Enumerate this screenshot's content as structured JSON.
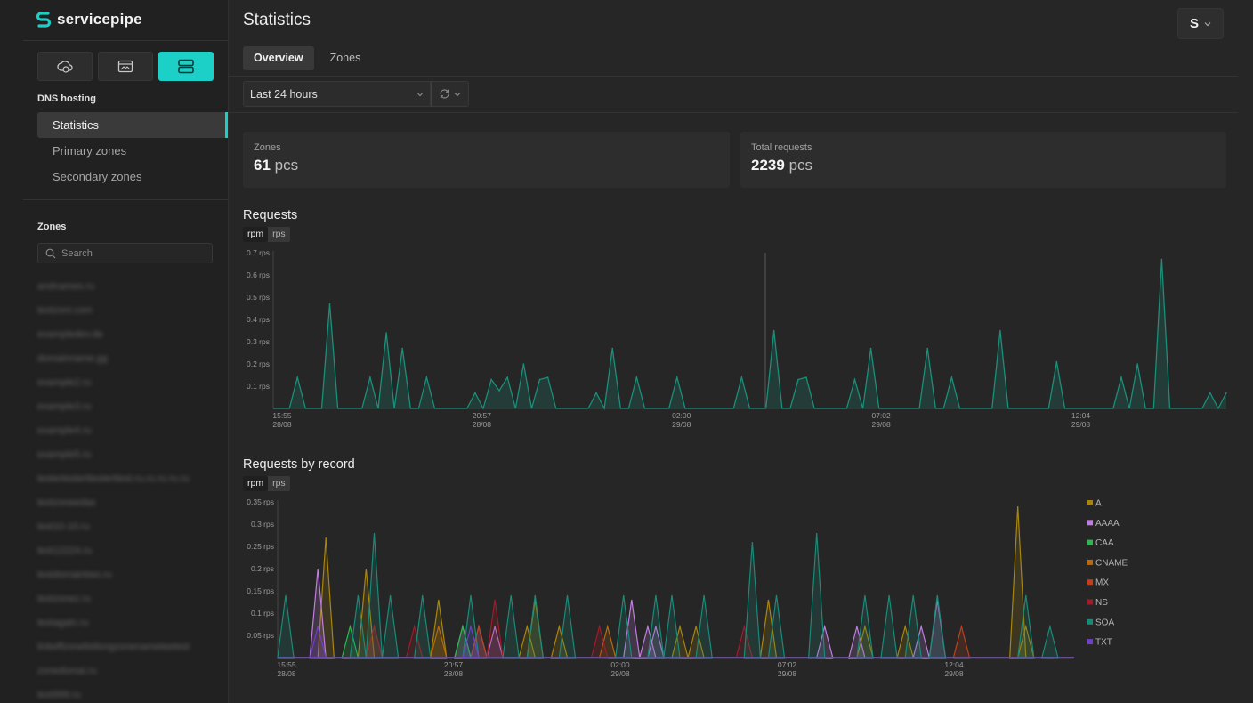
{
  "app": {
    "name": "servicepipe"
  },
  "sidebar": {
    "section_label": "DNS hosting",
    "nav": [
      "Statistics",
      "Primary zones",
      "Secondary zones"
    ],
    "zones_label": "Zones",
    "search_placeholder": "Search",
    "zones": [
      "andnames.ru",
      "testzoni.com",
      "exampledev.de",
      "domainname.gg",
      "example2.ru",
      "example3.ru",
      "example4.ru",
      "example5.ru",
      "testertesterttesterttest.ru.ru.ru.ru.ru",
      "testzoneedas",
      "test10-10.ru",
      "test12224.ru",
      "testdomaintwo.ru",
      "testzonez.ru",
      "testagain.ru",
      "linkeffzonelistlongzonenameteetest",
      "zonedomai.ru",
      "test999.ru"
    ]
  },
  "header": {
    "title": "Statistics",
    "user_initial": "S"
  },
  "tabs": [
    "Overview",
    "Zones"
  ],
  "filters": {
    "range": "Last 24 hours"
  },
  "cards": {
    "zones": {
      "label": "Zones",
      "value": "61",
      "unit": "pcs"
    },
    "requests": {
      "label": "Total requests",
      "value": "2239",
      "unit": "pcs"
    }
  },
  "requests": {
    "title": "Requests",
    "units": [
      "rpm",
      "rps"
    ],
    "selected_unit": "rpm"
  },
  "requests_by_record": {
    "title": "Requests by record",
    "units": [
      "rpm",
      "rps"
    ],
    "selected_unit": "rpm"
  },
  "colors": {
    "accent": "#1ccfc7",
    "line": "#1a8f7a"
  },
  "chart_data": [
    {
      "type": "area",
      "title": "Requests",
      "ylim": [
        0,
        0.7
      ],
      "yticks": [
        "0.1 rps",
        "0.2 rps",
        "0.3 rps",
        "0.4 rps",
        "0.5 rps",
        "0.6 rps",
        "0.7 rps"
      ],
      "xticks": [
        [
          "15:55",
          "28/08"
        ],
        [
          "20:57",
          "28/08"
        ],
        [
          "02:00",
          "29/08"
        ],
        [
          "07:02",
          "29/08"
        ],
        [
          "12:04",
          "29/08"
        ]
      ],
      "grid": false,
      "series": [
        {
          "values": [
            0,
            0,
            0,
            0.14,
            0,
            0,
            0,
            0.47,
            0,
            0,
            0,
            0,
            0.14,
            0,
            0.34,
            0,
            0.27,
            0,
            0,
            0.14,
            0,
            0,
            0,
            0,
            0,
            0.07,
            0,
            0.13,
            0.08,
            0.14,
            0,
            0.2,
            0,
            0.13,
            0.14,
            0,
            0,
            0,
            0,
            0,
            0.07,
            0,
            0.27,
            0,
            0,
            0.14,
            0,
            0,
            0,
            0,
            0.14,
            0,
            0,
            0,
            0,
            0,
            0,
            0,
            0.14,
            0,
            0,
            0,
            0.35,
            0,
            0,
            0.13,
            0.14,
            0,
            0,
            0,
            0,
            0,
            0.13,
            0,
            0.27,
            0,
            0,
            0,
            0,
            0,
            0,
            0.27,
            0,
            0,
            0.14,
            0,
            0,
            0,
            0,
            0,
            0.35,
            0,
            0,
            0,
            0,
            0,
            0,
            0.21,
            0,
            0,
            0,
            0,
            0,
            0,
            0,
            0.14,
            0,
            0.2,
            0,
            0,
            0.67,
            0,
            0,
            0,
            0,
            0,
            0.07,
            0,
            0.07
          ],
          "color": "#1a8f7a"
        }
      ]
    },
    {
      "type": "area",
      "title": "Requests by record",
      "ylim": [
        0,
        0.35
      ],
      "yticks": [
        "0.05 rps",
        "0.1 rps",
        "0.15 rps",
        "0.2 rps",
        "0.25 rps",
        "0.3 rps",
        "0.35 rps"
      ],
      "xticks": [
        [
          "15:55",
          "28/08"
        ],
        [
          "20:57",
          "28/08"
        ],
        [
          "02:00",
          "29/08"
        ],
        [
          "07:02",
          "29/08"
        ],
        [
          "12:04",
          "29/08"
        ]
      ],
      "legend_position": "right",
      "series": [
        {
          "name": "A",
          "color": "#a8860c",
          "points": [
            [
              6,
              0.27
            ],
            [
              11,
              0.2
            ],
            [
              20,
              0.13
            ],
            [
              31,
              0.07
            ],
            [
              32,
              0.13
            ],
            [
              35,
              0.07
            ],
            [
              50,
              0.07
            ],
            [
              52,
              0.07
            ],
            [
              61,
              0.13
            ],
            [
              73,
              0.07
            ],
            [
              78,
              0.07
            ],
            [
              92,
              0.34
            ],
            [
              93,
              0.07
            ]
          ]
        },
        {
          "name": "AAAA",
          "color": "#c07fe0",
          "points": [
            [
              5,
              0.2
            ],
            [
              23,
              0.07
            ],
            [
              25,
              0.07
            ],
            [
              27,
              0.07
            ],
            [
              44,
              0.13
            ],
            [
              46,
              0.07
            ],
            [
              47,
              0.07
            ],
            [
              68,
              0.07
            ],
            [
              72,
              0.07
            ],
            [
              80,
              0.07
            ],
            [
              82,
              0.13
            ]
          ]
        },
        {
          "name": "CAA",
          "color": "#2ab84f",
          "points": [
            [
              9,
              0.07
            ],
            [
              23,
              0.07
            ]
          ]
        },
        {
          "name": "CNAME",
          "color": "#b86a0d",
          "points": [
            [
              20,
              0.07
            ],
            [
              41,
              0.07
            ]
          ]
        },
        {
          "name": "MX",
          "color": "#c0401a",
          "points": [
            [
              12,
              0.07
            ],
            [
              25,
              0.07
            ],
            [
              85,
              0.07
            ]
          ]
        },
        {
          "name": "NS",
          "color": "#a01c2a",
          "points": [
            [
              12,
              0.07
            ],
            [
              17,
              0.07
            ],
            [
              27,
              0.13
            ],
            [
              40,
              0.07
            ],
            [
              58,
              0.07
            ]
          ]
        },
        {
          "name": "SOA",
          "color": "#1a8a78",
          "points": [
            [
              1,
              0.14
            ],
            [
              10,
              0.14
            ],
            [
              12,
              0.28
            ],
            [
              14,
              0.14
            ],
            [
              18,
              0.14
            ],
            [
              24,
              0.14
            ],
            [
              29,
              0.14
            ],
            [
              32,
              0.14
            ],
            [
              36,
              0.14
            ],
            [
              43,
              0.14
            ],
            [
              47,
              0.14
            ],
            [
              49,
              0.14
            ],
            [
              53,
              0.14
            ],
            [
              59,
              0.26
            ],
            [
              62,
              0.14
            ],
            [
              67,
              0.28
            ],
            [
              73,
              0.14
            ],
            [
              76,
              0.14
            ],
            [
              79,
              0.14
            ],
            [
              82,
              0.14
            ],
            [
              93,
              0.14
            ],
            [
              96,
              0.07
            ]
          ]
        },
        {
          "name": "TXT",
          "color": "#7040c8",
          "points": [
            [
              5,
              0.07
            ],
            [
              24,
              0.07
            ]
          ]
        }
      ]
    }
  ]
}
